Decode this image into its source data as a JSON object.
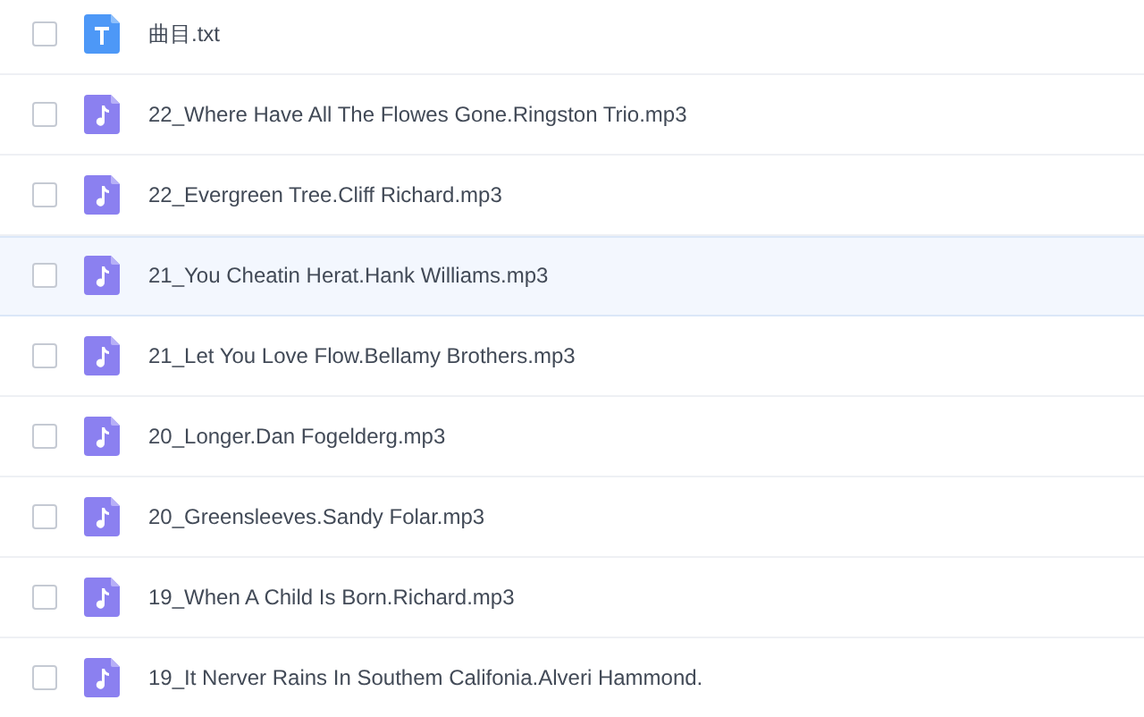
{
  "files": [
    {
      "kind": "text",
      "name": "曲目.txt",
      "checked": false,
      "highlighted": false
    },
    {
      "kind": "audio",
      "name": "22_Where Have All The Flowes Gone.Ringston Trio.mp3",
      "checked": false,
      "highlighted": false
    },
    {
      "kind": "audio",
      "name": "22_Evergreen Tree.Cliff Richard.mp3",
      "checked": false,
      "highlighted": false
    },
    {
      "kind": "audio",
      "name": "21_You Cheatin Herat.Hank Williams.mp3",
      "checked": false,
      "highlighted": true
    },
    {
      "kind": "audio",
      "name": "21_Let You Love Flow.Bellamy Brothers.mp3",
      "checked": false,
      "highlighted": false
    },
    {
      "kind": "audio",
      "name": "20_Longer.Dan Fogelderg.mp3",
      "checked": false,
      "highlighted": false
    },
    {
      "kind": "audio",
      "name": "20_Greensleeves.Sandy Folar.mp3",
      "checked": false,
      "highlighted": false
    },
    {
      "kind": "audio",
      "name": "19_When A Child Is Born.Richard.mp3",
      "checked": false,
      "highlighted": false
    },
    {
      "kind": "audio",
      "name": "19_It Nerver Rains In Southem Califonia.Alveri Hammond.",
      "checked": false,
      "highlighted": false
    }
  ]
}
